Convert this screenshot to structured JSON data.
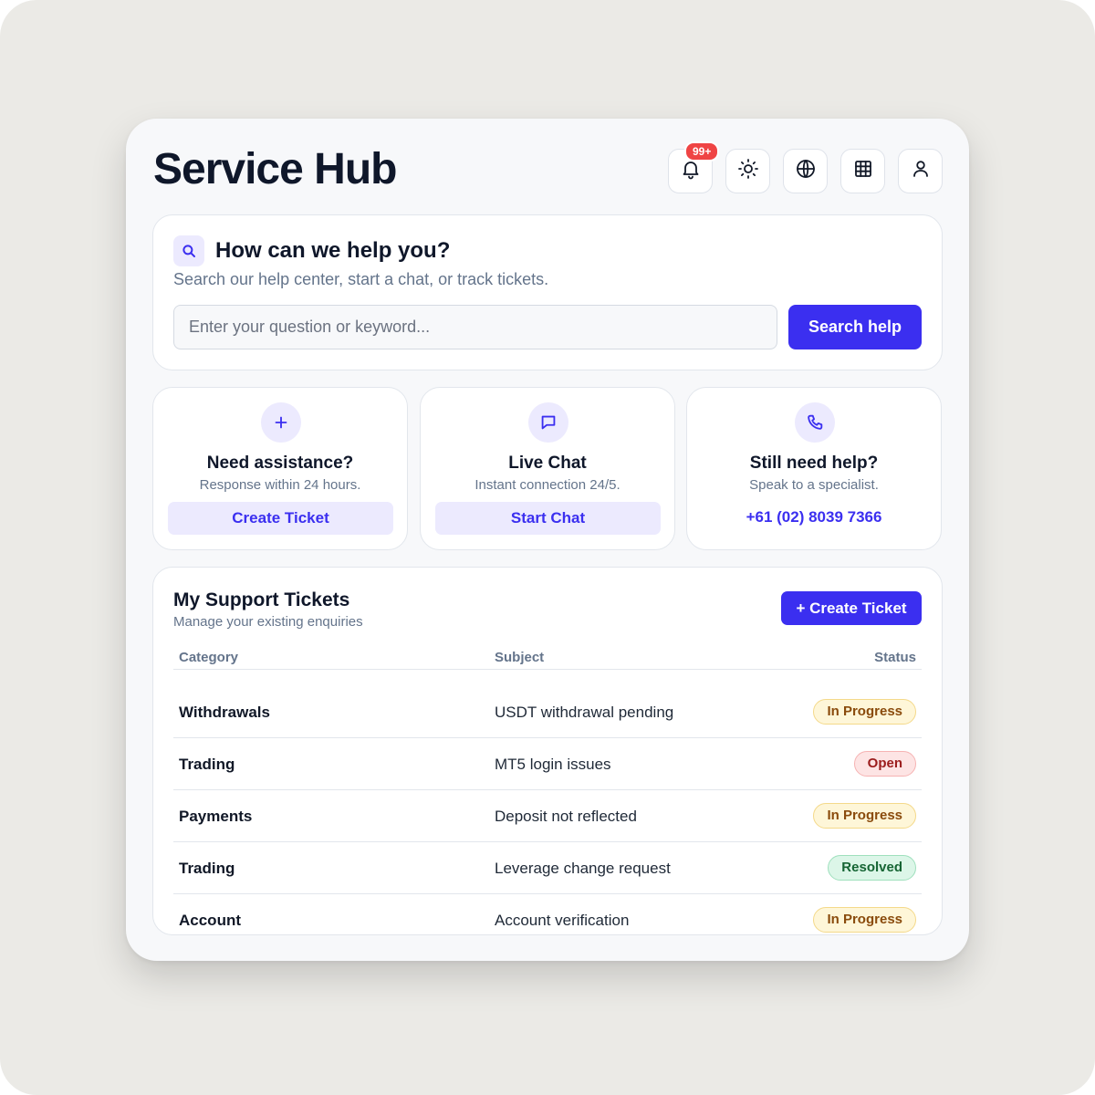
{
  "header": {
    "title": "Service Hub",
    "notification_badge": "99+",
    "icons": [
      "bell-icon",
      "sun-icon",
      "globe-icon",
      "grid-icon",
      "user-icon"
    ]
  },
  "search": {
    "title": "How can we help you?",
    "subtitle": "Search our help center, start a chat, or track tickets.",
    "placeholder": "Enter your question or keyword...",
    "button_label": "Search help"
  },
  "actions": [
    {
      "icon": "plus-icon",
      "title": "Need assistance?",
      "subtitle": "Response within 24 hours.",
      "button_label": "Create Ticket"
    },
    {
      "icon": "chat-icon",
      "title": "Live Chat",
      "subtitle": "Instant connection 24/5.",
      "button_label": "Start Chat"
    },
    {
      "icon": "phone-icon",
      "title": "Still need help?",
      "subtitle": "Speak to a specialist.",
      "link_label": "+61 (02) 8039 7366"
    }
  ],
  "tickets": {
    "title": "My Support Tickets",
    "subtitle": "Manage your existing enquiries",
    "create_label": "+ Create Ticket",
    "columns": [
      "Category",
      "Subject",
      "Status"
    ],
    "rows": [
      {
        "category": "Withdrawals",
        "subject": "USDT withdrawal pending",
        "status": "In Progress"
      },
      {
        "category": "Trading",
        "subject": "MT5 login issues",
        "status": "Open"
      },
      {
        "category": "Payments",
        "subject": "Deposit not reflected",
        "status": "In Progress"
      },
      {
        "category": "Trading",
        "subject": "Leverage change request",
        "status": "Resolved"
      },
      {
        "category": "Account",
        "subject": "Account verification",
        "status": "In Progress"
      }
    ]
  },
  "colors": {
    "accent": "#3b2ff0",
    "in_progress": "#fef6d8",
    "open": "#fde4e4",
    "resolved": "#dcf6e8"
  }
}
